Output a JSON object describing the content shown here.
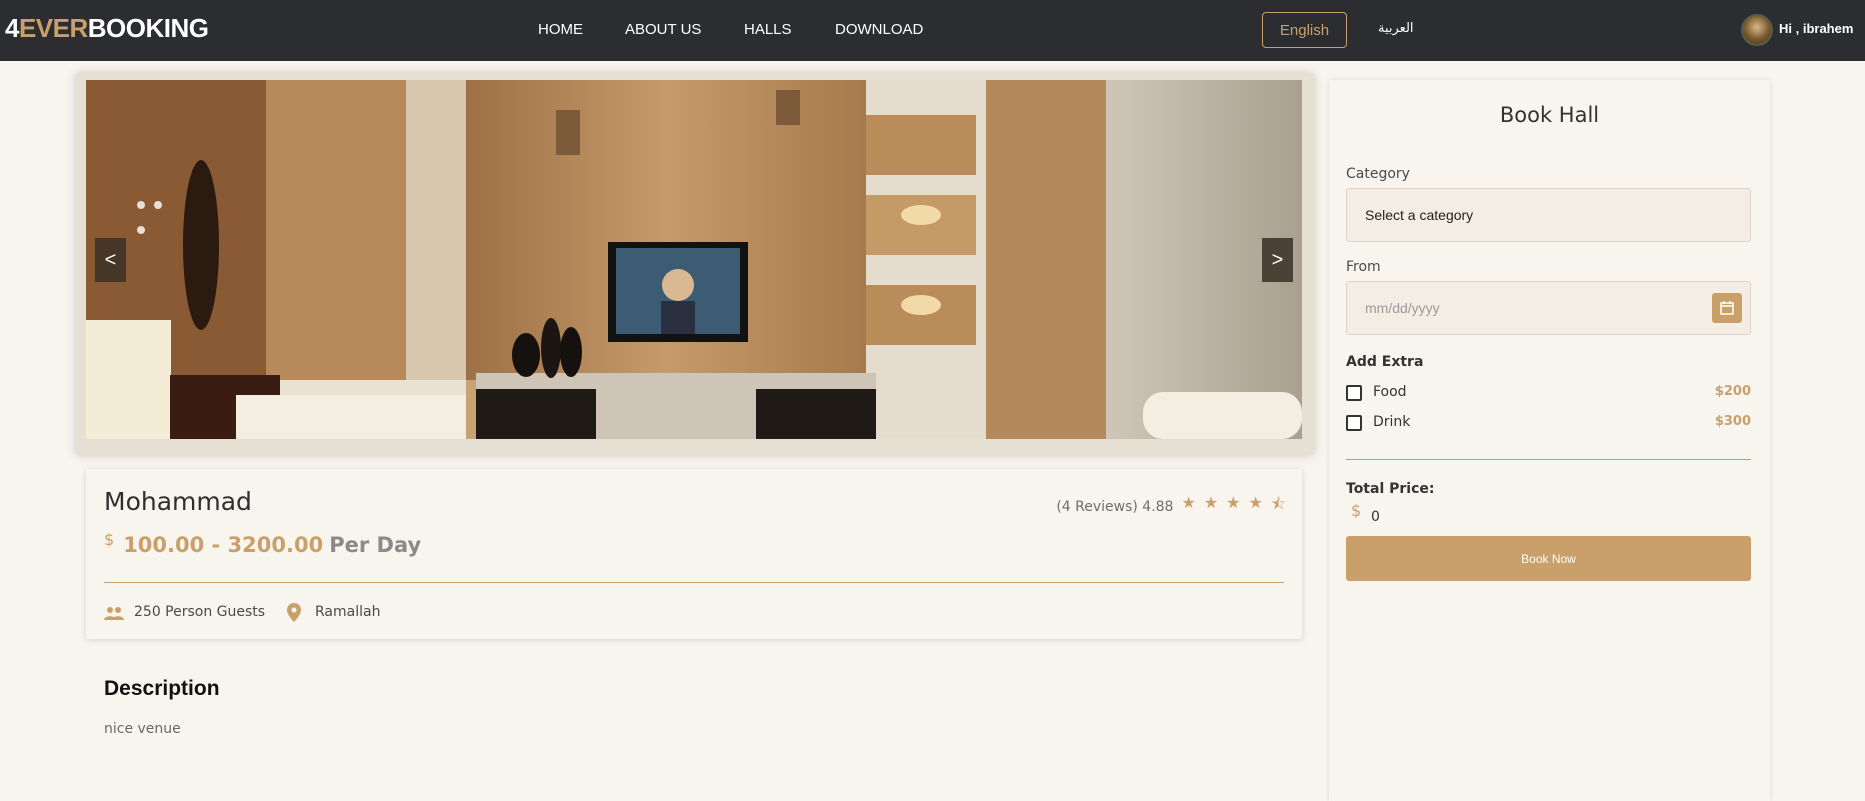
{
  "brand": {
    "part1": "4",
    "part2": "EVER",
    "part3": "BOOKING"
  },
  "nav": {
    "links": [
      "HOME",
      "ABOUT US",
      "HALLS",
      "DOWNLOAD"
    ],
    "lang_en": "English",
    "lang_ar": "العربية",
    "user_greeting": "Hi , ibrahem"
  },
  "carousel": {
    "prev_label": "<",
    "next_label": ">"
  },
  "hall": {
    "name": "Mohammad",
    "currency_symbol": "$",
    "price_range": "100.00 - 3200.00",
    "per_day": "Per Day",
    "reviews_text": "(4 Reviews) 4.88",
    "rating": 4.88,
    "guests": "250 Person Guests",
    "location": "Ramallah",
    "guests_icon": "people-icon",
    "location_icon": "location-pin-icon"
  },
  "description": {
    "title": "Description",
    "text": "nice venue"
  },
  "booking": {
    "title": "Book Hall",
    "category_label": "Category",
    "category_value": "Select a category",
    "from_label": "From",
    "from_placeholder": "mm/dd/yyyy",
    "add_extra_title": "Add Extra",
    "extras": [
      {
        "label": "Food",
        "price": "$200",
        "checked": false
      },
      {
        "label": "Drink",
        "price": "$300",
        "checked": false
      }
    ],
    "total_label": "Total Price:",
    "total_currency": "$",
    "total_value": "0",
    "book_button": "Book Now"
  },
  "colors": {
    "accent": "#c9a06a",
    "navbar_bg": "#2c2d31",
    "page_bg": "#f8f5ef",
    "text_dark": "#2f2f2f"
  }
}
